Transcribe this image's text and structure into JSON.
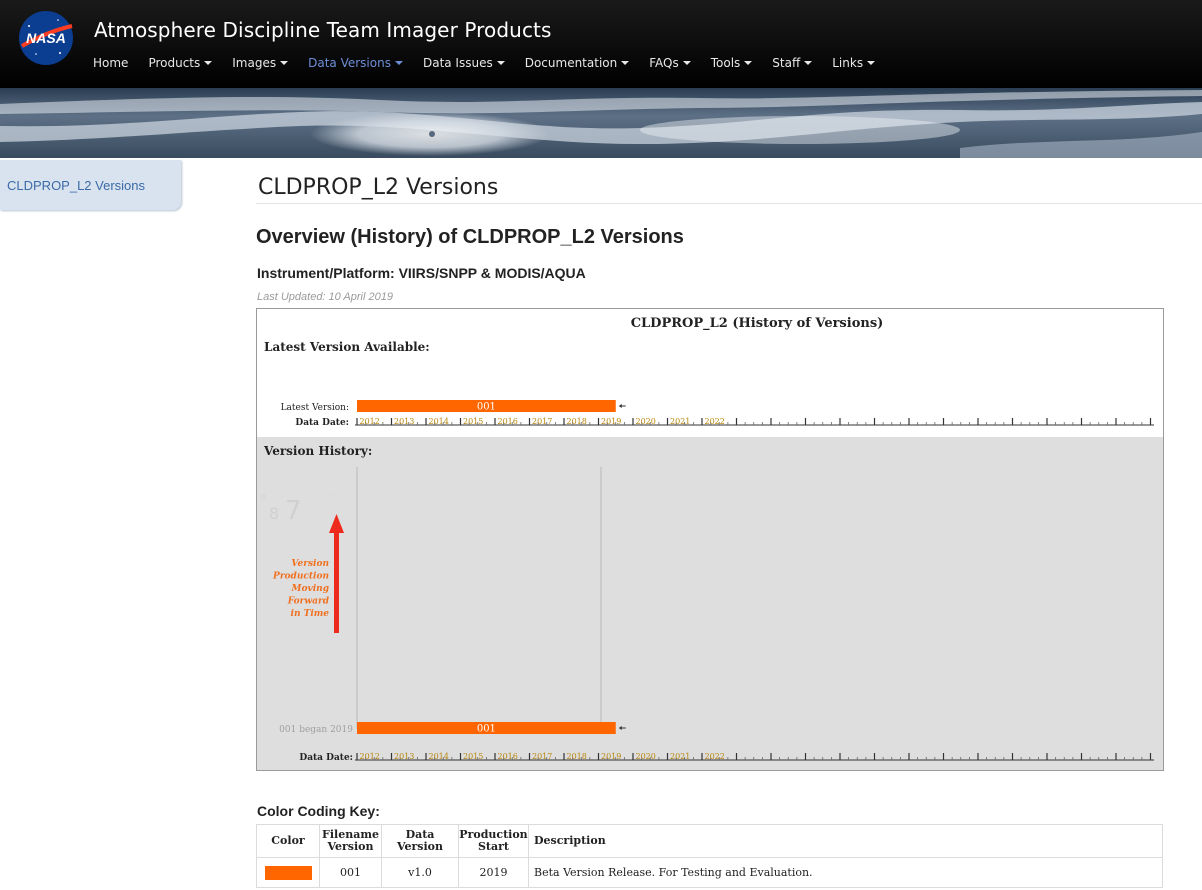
{
  "header": {
    "site_title": "Atmosphere Discipline Team Imager Products",
    "logo_text": "NASA",
    "nav": [
      {
        "label": "Home",
        "dropdown": false
      },
      {
        "label": "Products",
        "dropdown": true
      },
      {
        "label": "Images",
        "dropdown": true
      },
      {
        "label": "Data Versions",
        "dropdown": true,
        "active": true
      },
      {
        "label": "Data Issues",
        "dropdown": true
      },
      {
        "label": "Documentation",
        "dropdown": true
      },
      {
        "label": "FAQs",
        "dropdown": true
      },
      {
        "label": "Tools",
        "dropdown": true
      },
      {
        "label": "Staff",
        "dropdown": true
      },
      {
        "label": "Links",
        "dropdown": true
      }
    ]
  },
  "sidebar": {
    "items": [
      {
        "label": "CLDPROP_L2 Versions"
      }
    ]
  },
  "main": {
    "page_title": "CLDPROP_L2 Versions",
    "overview_heading": "Overview (History) of CLDPROP_L2 Versions",
    "instrument": "Instrument/Platform: VIIRS/SNPP & MODIS/AQUA",
    "last_updated": "Last Updated: 10 April 2019"
  },
  "timeline": {
    "title": "CLDPROP_L2 (History of Versions)",
    "latest_heading": "Latest Version Available:",
    "latest_label": "Latest Version:",
    "data_date_label": "Data Date:",
    "history_heading": "Version History:",
    "history_row_label": "001 began 2019",
    "arrow_caption": "Version\nProduction\nMoving\nForward\nin Time",
    "years": [
      "2012",
      "2013",
      "2014",
      "2015",
      "2016",
      "2017",
      "2018",
      "2019",
      "2020",
      "2021",
      "2022"
    ],
    "versions": [
      {
        "name": "001",
        "start_year": 2012,
        "end_year": 2019,
        "color": "#ff6600"
      }
    ],
    "colors": {
      "bar": "#ff6600",
      "year_text": "#b8860b",
      "history_bg": "#dedede"
    }
  },
  "key": {
    "heading": "Color Coding Key:",
    "columns": [
      "Color",
      "Filename\nVersion",
      "Data\nVersion",
      "Production\nStart",
      "Description"
    ],
    "rows": [
      {
        "color": "#ff6600",
        "filename_version": "001",
        "data_version": "v1.0",
        "production_start": "2019",
        "description": "Beta Version Release.  For Testing and Evaluation."
      }
    ]
  }
}
